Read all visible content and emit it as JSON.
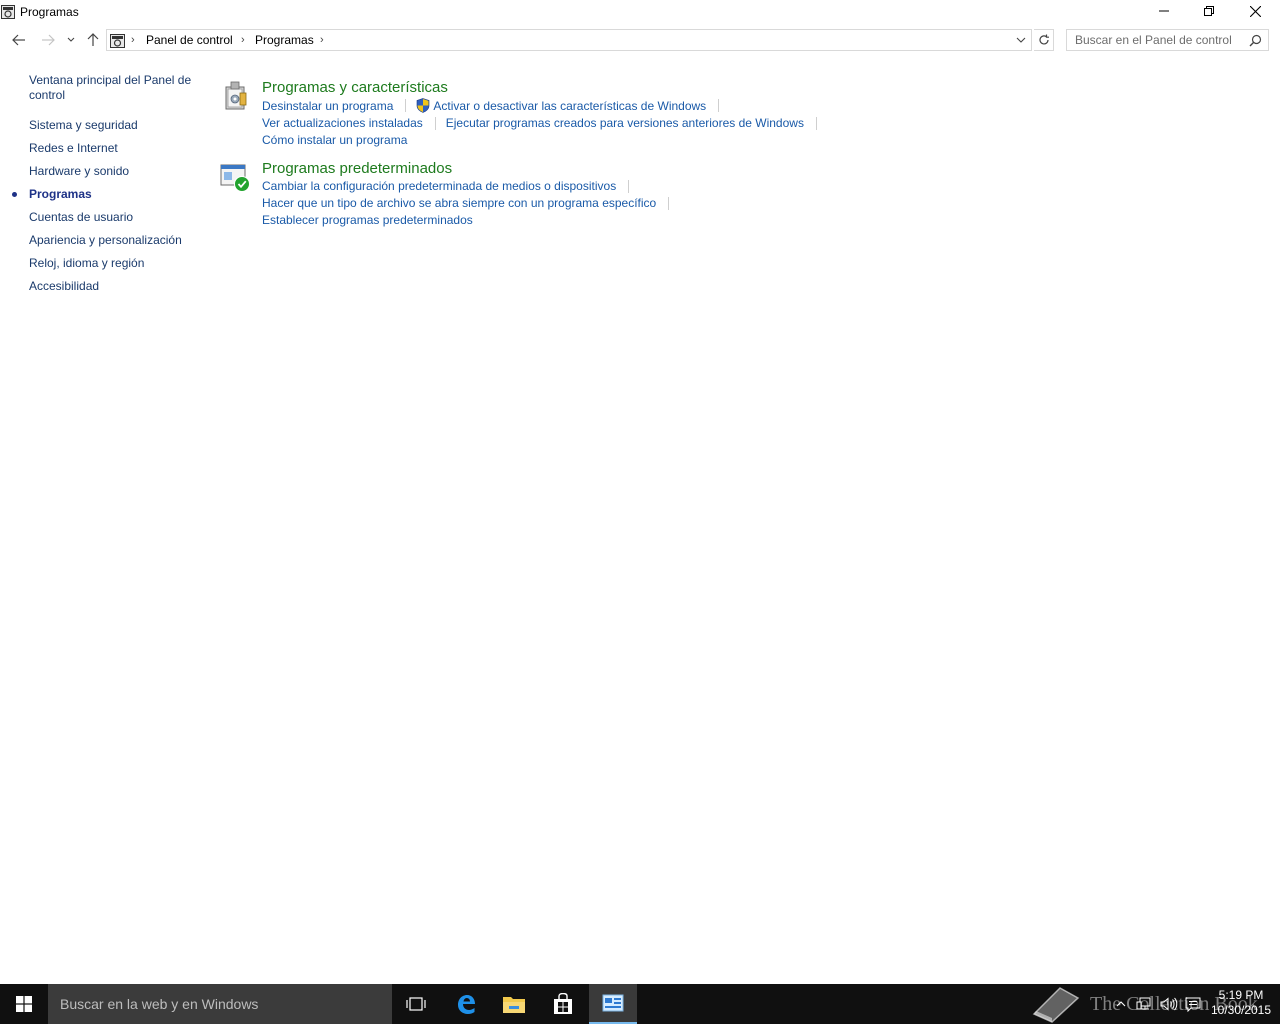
{
  "window": {
    "title": "Programas"
  },
  "address": {
    "crumbs": [
      "Panel de control",
      "Programas"
    ]
  },
  "search": {
    "placeholder": "Buscar en el Panel de control"
  },
  "leftnav": {
    "home": "Ventana principal del Panel de control",
    "items": [
      {
        "label": "Sistema y seguridad",
        "current": false
      },
      {
        "label": "Redes e Internet",
        "current": false
      },
      {
        "label": "Hardware y sonido",
        "current": false
      },
      {
        "label": "Programas",
        "current": true
      },
      {
        "label": "Cuentas de usuario",
        "current": false
      },
      {
        "label": "Apariencia y personalización",
        "current": false
      },
      {
        "label": "Reloj, idioma y región",
        "current": false
      },
      {
        "label": "Accesibilidad",
        "current": false
      }
    ]
  },
  "sections": [
    {
      "title": "Programas y características",
      "icon": "programs-features-icon",
      "links": [
        "Desinstalar un programa",
        "Activar o desactivar las características de Windows",
        "Ver actualizaciones instaladas",
        "Ejecutar programas creados para versiones anteriores de Windows",
        "Cómo instalar un programa"
      ]
    },
    {
      "title": "Programas predeterminados",
      "icon": "default-programs-icon",
      "links": [
        "Cambiar la configuración predeterminada de medios o dispositivos",
        "Hacer que un tipo de archivo se abra siempre con un programa específico",
        "Establecer programas predeterminados"
      ]
    }
  ],
  "taskbar": {
    "search_text": "Buscar en la web y en Windows",
    "apps": [
      "task-view-icon",
      "edge-icon",
      "file-explorer-icon",
      "store-icon",
      "control-panel-icon"
    ],
    "clock_time": "5:19 PM",
    "clock_date": "10/30/2015",
    "watermark": "The Collection Book"
  },
  "colors": {
    "link": "#1a5aa8",
    "section_title": "#1e7b1e",
    "taskbar": "#101010",
    "accent": "#76b9ed"
  }
}
